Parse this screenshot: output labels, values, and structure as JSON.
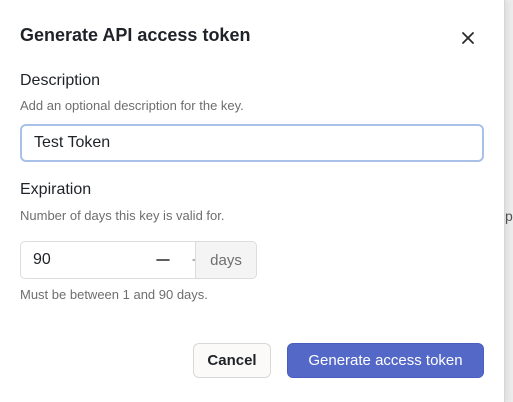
{
  "dialog": {
    "title": "Generate API access token",
    "close_icon": "close-icon"
  },
  "description": {
    "label": "Description",
    "helper": "Add an optional description for the key.",
    "value": "Test Token"
  },
  "expiration": {
    "label": "Expiration",
    "helper": "Number of days this key is valid for.",
    "value": "90",
    "decrement_icon": "minus-icon",
    "increment_icon": "plus-icon",
    "unit": "days",
    "hint": "Must be between 1 and 90 days."
  },
  "actions": {
    "cancel_label": "Cancel",
    "submit_label": "Generate access token"
  },
  "background": {
    "partial_glyph": "p"
  },
  "colors": {
    "primary": "#5468c8",
    "focus_border": "#a9c0e8"
  }
}
